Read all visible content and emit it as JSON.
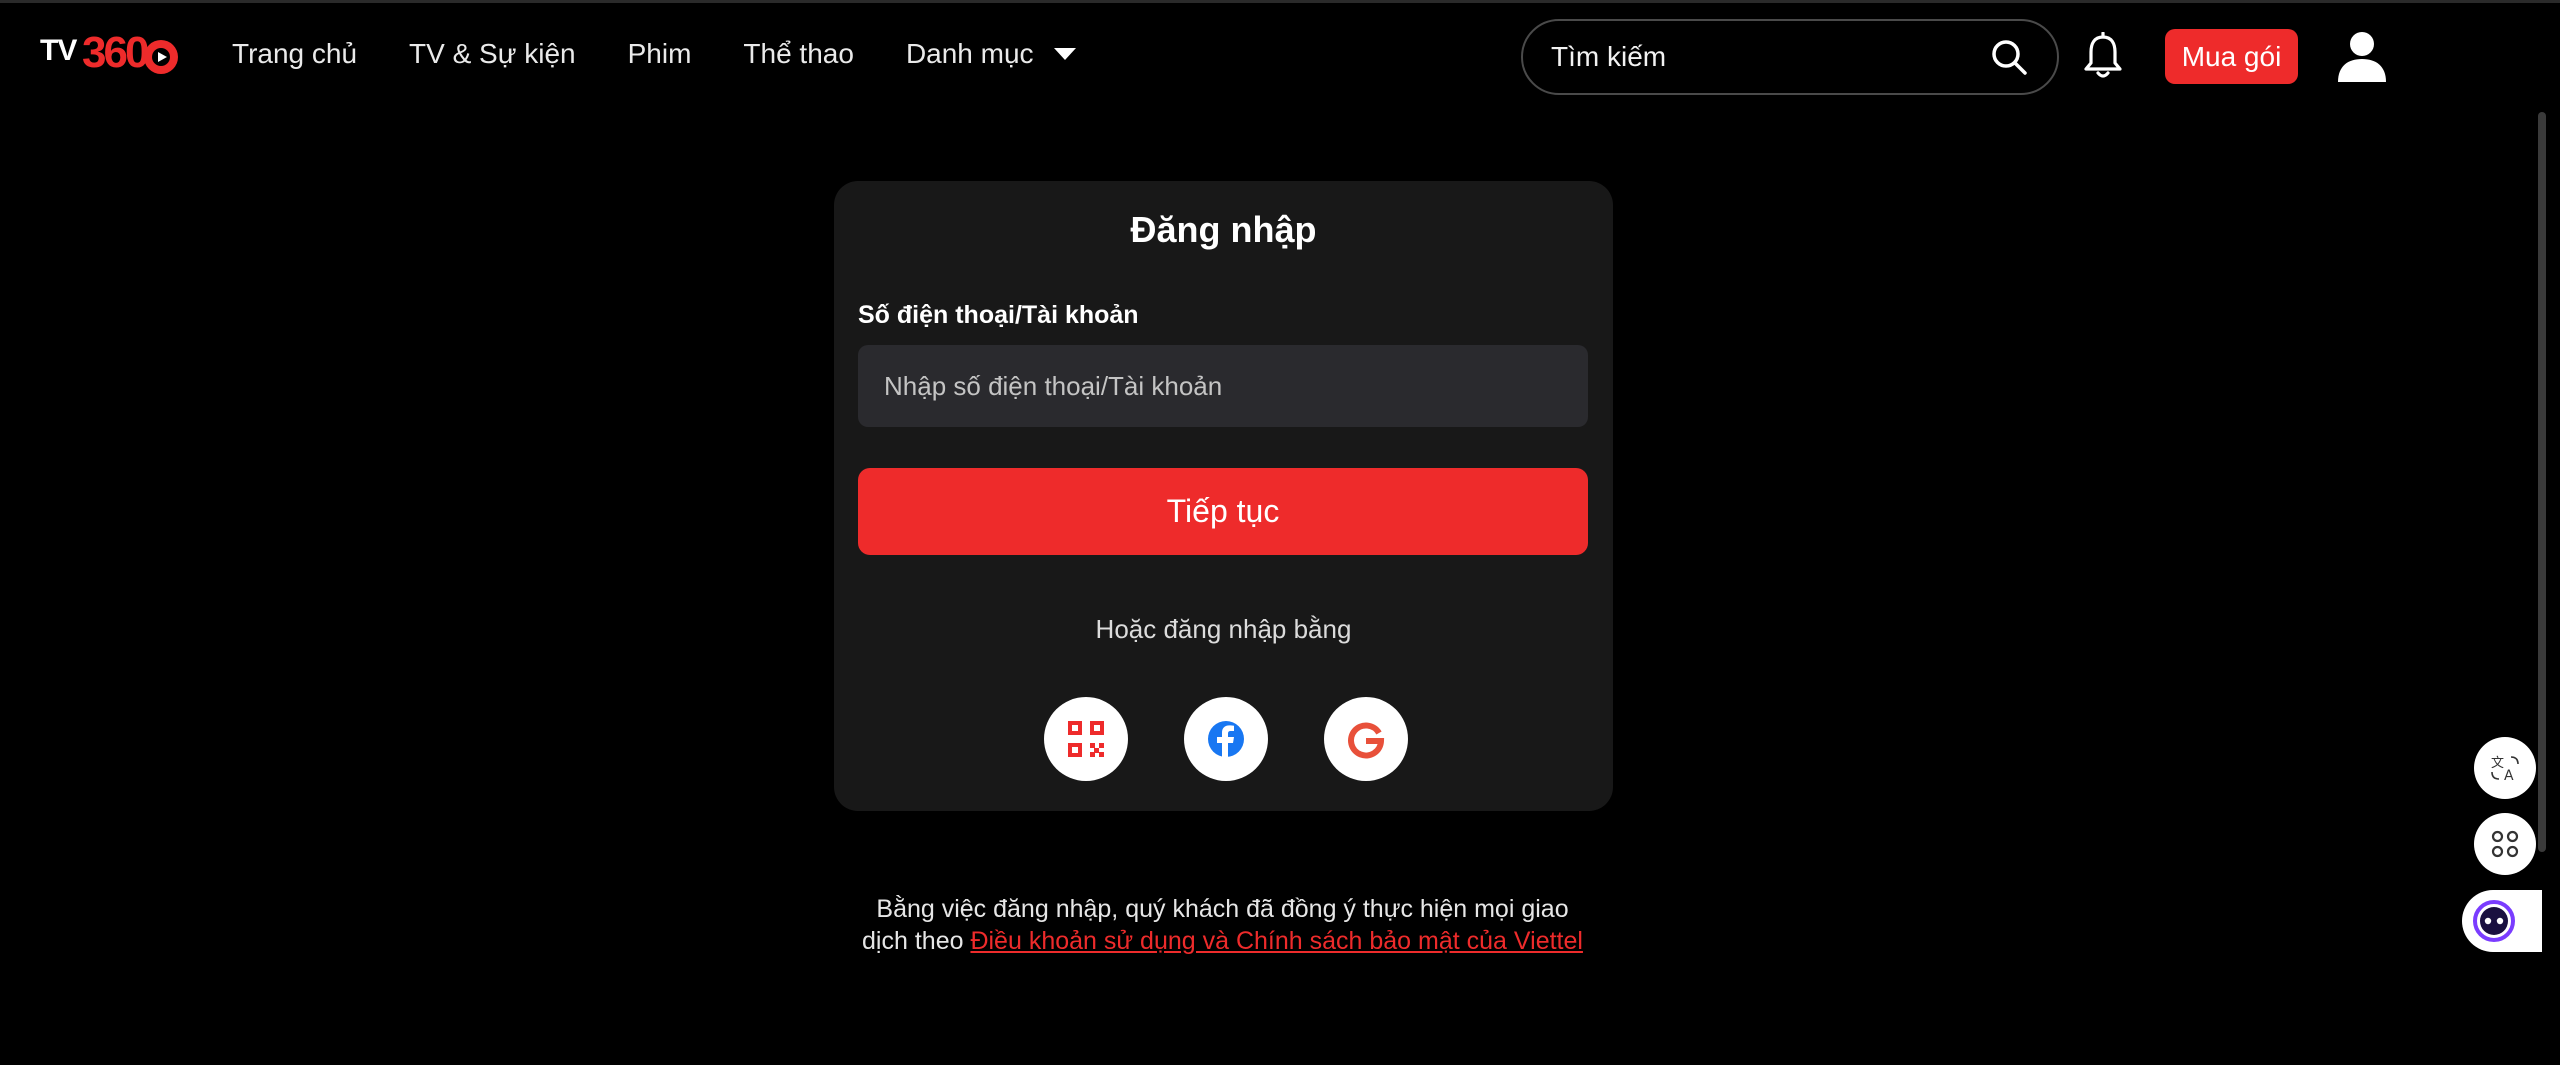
{
  "header": {
    "logo": {
      "text_tv": "TV",
      "text_num": "360"
    },
    "nav": [
      {
        "label": "Trang chủ"
      },
      {
        "label": "TV & Sự kiện"
      },
      {
        "label": "Phim"
      },
      {
        "label": "Thể thao"
      },
      {
        "label": "Danh mục"
      }
    ],
    "search": {
      "placeholder": "Tìm kiếm"
    },
    "buy_label": "Mua gói"
  },
  "login": {
    "title": "Đăng nhập",
    "field_label": "Số điện thoại/Tài khoản",
    "field_placeholder": "Nhập số điện thoại/Tài khoản",
    "continue_label": "Tiếp tục",
    "or_label": "Hoặc đăng nhập bằng",
    "socials": [
      "qr-code-icon",
      "facebook-icon",
      "google-icon"
    ]
  },
  "terms": {
    "prefix": "Bằng việc đăng nhập, quý khách đã đồng ý thực hiện mọi giao dịch theo",
    "link": "Điều khoản sử dụng và Chính sách bảo mật của Viettel"
  },
  "colors": {
    "accent": "#ee2b2b",
    "background": "#000000",
    "card": "#181818",
    "field": "#2a2a2e",
    "facebook": "#1877f2"
  }
}
